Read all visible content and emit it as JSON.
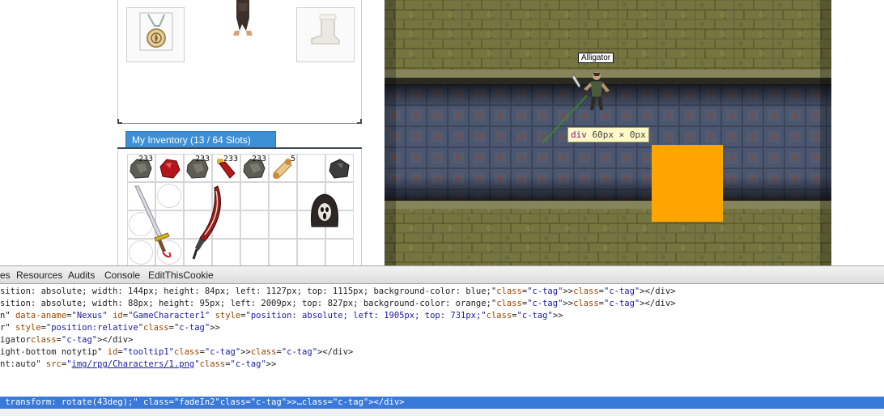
{
  "inventory": {
    "tab_label": "My Inventory (13 / 64 Slots)",
    "counts": [
      "233",
      "233",
      "233",
      "233",
      "5"
    ]
  },
  "equipment": {
    "amulet_icon": "medallion-icon",
    "boots_icon": "boots-icon"
  },
  "game": {
    "character_name": "Alligator",
    "highlight_tooltip": {
      "tag": "div",
      "size": "60px × 0px"
    },
    "box_color": "#ffa500"
  },
  "devtools": {
    "tabs": [
      "es",
      "Resources",
      "Audits",
      "Console",
      "EditThisCookie"
    ],
    "lines": [
      "sition: absolute; width: 144px; height: 84px; left: 1127px; top: 1115px; background-color: blue;\"></div>",
      "sition: absolute; width: 88px; height: 95px; left: 2009px; top: 827px; background-color: orange;\"></div>",
      "n\" data-aname=\"Nexus\" id=\"GameCharacter1\" style=\"position: absolute; left: 1905px; top: 731px;\">",
      "r\" style=\"position:relative\">",
      "igator</div>",
      "ight-bottom notytip\" id=\"tooltip1\"></div>",
      "nt:auto\" src=\"img/rpg/Characters/1.png\">",
      "",
      "",
      " transform: rotate(43deg);\" class=\"fadeIn2\">…</div>"
    ]
  }
}
